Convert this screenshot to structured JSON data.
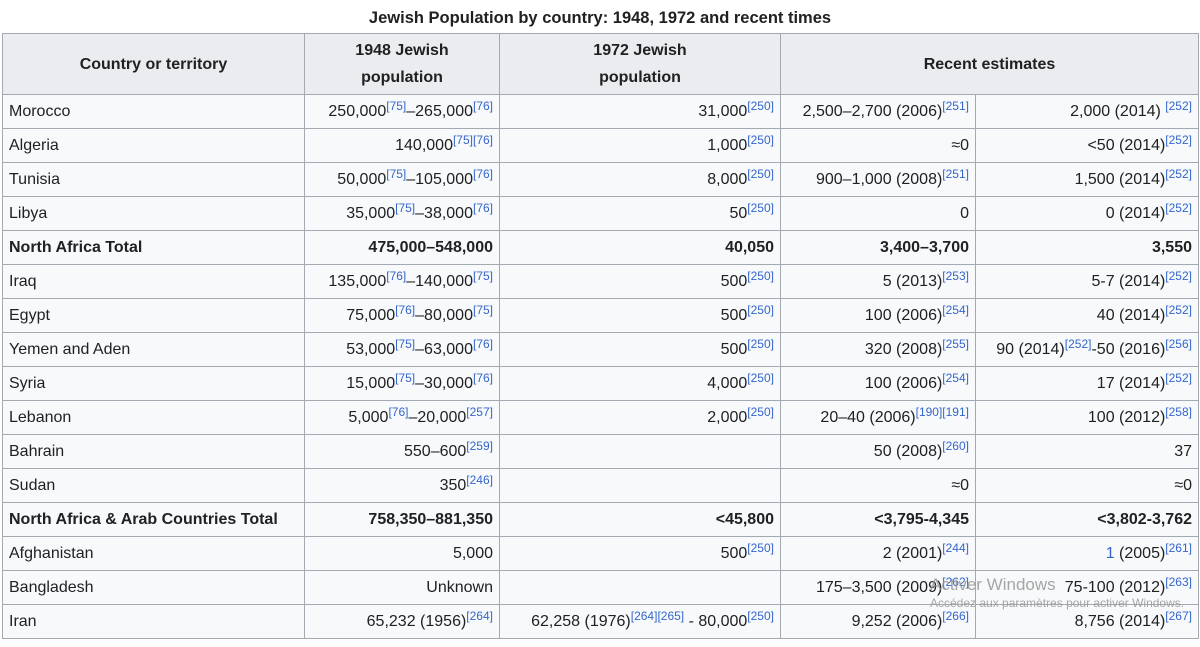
{
  "caption": "Jewish Population by country: 1948, 1972 and recent times",
  "headers": [
    "Country or territory",
    "1948 Jewish population",
    "1972 Jewish population",
    "Recent estimates"
  ],
  "rows": [
    {
      "country": "Morocco",
      "total": false,
      "c1": [
        [
          "250,000",
          "[75]"
        ],
        [
          "–265,000",
          "[76]"
        ]
      ],
      "c2": [
        [
          "31,000",
          "[250]"
        ]
      ],
      "c3": [
        [
          "2,500–2,700 (2006)",
          "[251]"
        ]
      ],
      "c4": [
        [
          "2,000 (2014) ",
          "[252]"
        ]
      ]
    },
    {
      "country": "Algeria",
      "total": false,
      "c1": [
        [
          "140,000",
          "[75]"
        ],
        [
          "",
          "[76]"
        ]
      ],
      "c2": [
        [
          "1,000",
          "[250]"
        ]
      ],
      "c3": [
        [
          "≈0",
          ""
        ]
      ],
      "c4": [
        [
          "<50 (2014)",
          "[252]"
        ]
      ]
    },
    {
      "country": "Tunisia",
      "total": false,
      "c1": [
        [
          "50,000",
          "[75]"
        ],
        [
          "–105,000",
          "[76]"
        ]
      ],
      "c2": [
        [
          "8,000",
          "[250]"
        ]
      ],
      "c3": [
        [
          "900–1,000 (2008)",
          "[251]"
        ]
      ],
      "c4": [
        [
          "1,500 (2014)",
          "[252]"
        ]
      ]
    },
    {
      "country": "Libya",
      "total": false,
      "c1": [
        [
          "35,000",
          "[75]"
        ],
        [
          "–38,000",
          "[76]"
        ]
      ],
      "c2": [
        [
          "50",
          "[250]"
        ]
      ],
      "c3": [
        [
          "0",
          ""
        ]
      ],
      "c4": [
        [
          "0 (2014)",
          "[252]"
        ]
      ]
    },
    {
      "country": "North Africa Total",
      "total": true,
      "c1": [
        [
          "475,000–548,000",
          ""
        ]
      ],
      "c2": [
        [
          "40,050",
          ""
        ]
      ],
      "c3": [
        [
          "3,400–3,700",
          ""
        ]
      ],
      "c4": [
        [
          "3,550",
          ""
        ]
      ]
    },
    {
      "country": "Iraq",
      "total": false,
      "c1": [
        [
          "135,000",
          "[76]"
        ],
        [
          "–140,000",
          "[75]"
        ]
      ],
      "c2": [
        [
          "500",
          "[250]"
        ]
      ],
      "c3": [
        [
          "5 (2013)",
          "[253]"
        ]
      ],
      "c4": [
        [
          "5-7 (2014)",
          "[252]"
        ]
      ]
    },
    {
      "country": "Egypt",
      "total": false,
      "c1": [
        [
          "75,000",
          "[76]"
        ],
        [
          "–80,000",
          "[75]"
        ]
      ],
      "c2": [
        [
          "500",
          "[250]"
        ]
      ],
      "c3": [
        [
          "100 (2006)",
          "[254]"
        ]
      ],
      "c4": [
        [
          "40 (2014)",
          "[252]"
        ]
      ]
    },
    {
      "country": "Yemen and Aden",
      "total": false,
      "c1": [
        [
          "53,000",
          "[75]"
        ],
        [
          "–63,000",
          "[76]"
        ]
      ],
      "c2": [
        [
          "500",
          "[250]"
        ]
      ],
      "c3": [
        [
          "320 (2008)",
          "[255]"
        ]
      ],
      "c4": [
        [
          "90 (2014)",
          "[252]"
        ],
        [
          "-50 (2016)",
          "[256]"
        ]
      ]
    },
    {
      "country": "Syria",
      "total": false,
      "c1": [
        [
          "15,000",
          "[75]"
        ],
        [
          "–30,000",
          "[76]"
        ]
      ],
      "c2": [
        [
          "4,000",
          "[250]"
        ]
      ],
      "c3": [
        [
          "100 (2006)",
          "[254]"
        ]
      ],
      "c4": [
        [
          "17 (2014)",
          "[252]"
        ]
      ]
    },
    {
      "country": "Lebanon",
      "total": false,
      "c1": [
        [
          "5,000",
          "[76]"
        ],
        [
          "–20,000",
          "[257]"
        ]
      ],
      "c2": [
        [
          "2,000",
          "[250]"
        ]
      ],
      "c3": [
        [
          "20–40 (2006)",
          "[190][191]"
        ]
      ],
      "c4": [
        [
          "100 (2012)",
          "[258]"
        ]
      ]
    },
    {
      "country": "Bahrain",
      "total": false,
      "c1": [
        [
          "550–600",
          "[259]"
        ]
      ],
      "c2": [],
      "c3": [
        [
          "50 (2008)",
          "[260]"
        ]
      ],
      "c4": [
        [
          "37",
          ""
        ]
      ]
    },
    {
      "country": "Sudan",
      "total": false,
      "c1": [
        [
          "350",
          "[246]"
        ]
      ],
      "c2": [],
      "c3": [
        [
          "≈0",
          ""
        ]
      ],
      "c4": [
        [
          "≈0",
          ""
        ]
      ]
    },
    {
      "country": "North Africa & Arab Countries Total",
      "total": true,
      "c1": [
        [
          "758,350–881,350",
          ""
        ]
      ],
      "c2": [
        [
          "<45,800",
          ""
        ]
      ],
      "c3": [
        [
          "<3,795-4,345",
          ""
        ]
      ],
      "c4": [
        [
          "<3,802-3,762",
          ""
        ]
      ]
    },
    {
      "country": "Afghanistan",
      "total": false,
      "c1": [
        [
          "5,000",
          ""
        ]
      ],
      "c2": [
        [
          "500",
          "[250]"
        ]
      ],
      "c3": [
        [
          "2 (2001)",
          "[244]"
        ]
      ],
      "c4": [
        [
          "1",
          ""
        ],
        [
          " (2005)",
          "[261]"
        ]
      ]
    },
    {
      "country": "Bangladesh",
      "total": false,
      "c1": [
        [
          "Unknown",
          ""
        ]
      ],
      "c2": [],
      "c3": [
        [
          "175–3,500 (2009)",
          "[262]"
        ]
      ],
      "c4": [
        [
          "75-100 (2012)",
          "[263]"
        ]
      ]
    },
    {
      "country": "Iran",
      "total": false,
      "c1": [
        [
          "65,232 (1956)",
          "[264]"
        ]
      ],
      "c2": [
        [
          "62,258 (1976)",
          "[264][265]"
        ],
        [
          " - 80,000",
          "[250]"
        ]
      ],
      "c3": [
        [
          "9,252 (2006)",
          "[266]"
        ]
      ],
      "c4": [
        [
          "8,756 (2014)",
          "[267]"
        ]
      ]
    }
  ],
  "watermark": {
    "line1": "Activer Windows",
    "line2": "Accédez aux paramètres pour activer Windows."
  },
  "colors": {
    "link": "#3366cc",
    "header_bg": "#eaecf0",
    "cell_bg": "#f8f9fa",
    "border": "#a2a9b1",
    "text": "#202122"
  }
}
